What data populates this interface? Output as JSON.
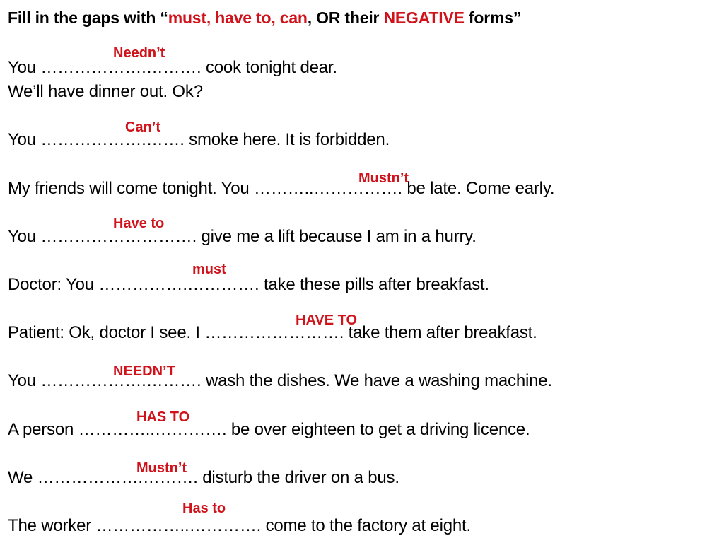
{
  "title": {
    "prefix": "Fill in the gaps with “",
    "red1": "must,  have to, can",
    "mid": ", OR their ",
    "red2": "NEGATIVE",
    "suffix": " forms”"
  },
  "accent_color": "#d0121b",
  "items": [
    {
      "lines": [
        "You ……………….………. cook tonight dear.",
        "We’ll have dinner out. Ok?"
      ],
      "answer": "Needn’t"
    },
    {
      "lines": [
        "You ……………….…….  smoke here. It is forbidden."
      ],
      "answer": "Can’t"
    },
    {
      "lines": [
        "My friends will come tonight. You ………..……………. be late. Come early."
      ],
      "answer": "Mustn’t"
    },
    {
      "lines": [
        "You ………………………. give me a lift because I am in a hurry."
      ],
      "answer": "Have to"
    },
    {
      "lines": [
        "Doctor: You …………….…………. take these pills after breakfast."
      ],
      "answer": "must"
    },
    {
      "lines": [
        "Patient: Ok, doctor I see. I …………………….  take them after breakfast."
      ],
      "answer": "HAVE TO"
    },
    {
      "lines": [
        "You ……………….……….  wash the dishes. We have a washing machine."
      ],
      "answer": "NEEDN’T"
    },
    {
      "lines": [
        "A person …………..………….  be over eighteen to get a driving licence."
      ],
      "answer": "HAS TO"
    },
    {
      "lines": [
        "We ……………….……….  disturb the driver on a bus."
      ],
      "answer": "Mustn’t"
    },
    {
      "lines": [
        "The worker ……………..………….  come to the factory at eight."
      ],
      "answer": "Has to"
    }
  ]
}
